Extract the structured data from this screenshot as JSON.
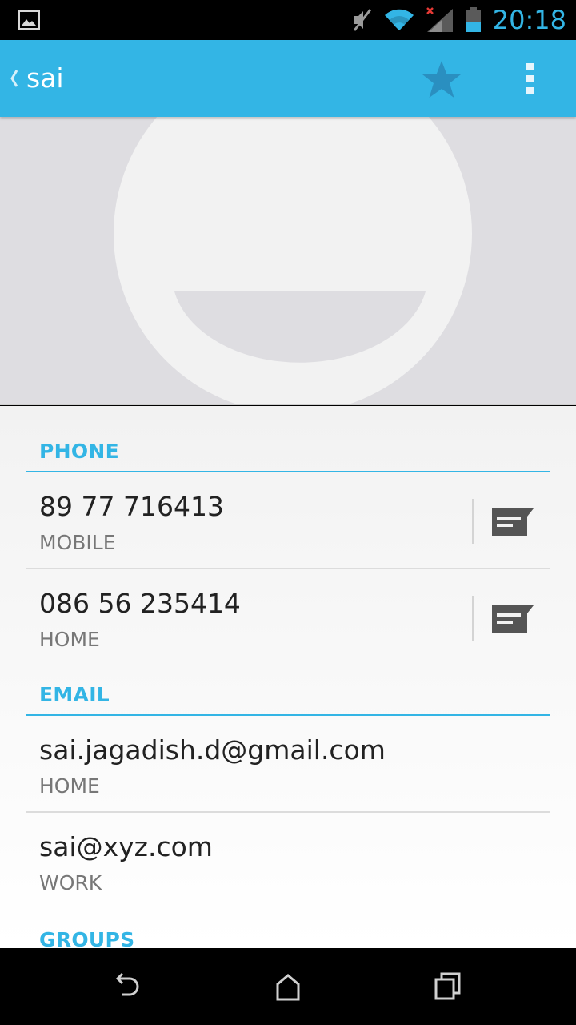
{
  "status_bar": {
    "time": "20:18",
    "icons": [
      "gallery-icon",
      "mute-icon",
      "wifi-icon",
      "signal-icon",
      "battery-icon"
    ],
    "time_color": "#33b5e5"
  },
  "action_bar": {
    "title": "sai",
    "background": "#33b5e5",
    "icons": [
      "up-arrow-icon",
      "star-icon",
      "overflow-menu-icon"
    ]
  },
  "contact_photo": {
    "icon": "default-contact-avatar-icon"
  },
  "sections": {
    "phone": {
      "header": "PHONE",
      "entries": [
        {
          "value": "89 77 716413",
          "label": "MOBILE"
        },
        {
          "value": "086 56 235414",
          "label": "HOME"
        }
      ]
    },
    "email": {
      "header": "EMAIL",
      "entries": [
        {
          "value": "sai.jagadish.d@gmail.com",
          "label": "HOME"
        },
        {
          "value": "sai@xyz.com",
          "label": "WORK"
        }
      ]
    },
    "groups": {
      "header": "GROUPS"
    }
  },
  "nav_bar": {
    "buttons": [
      "back-icon",
      "home-icon",
      "recents-icon"
    ]
  }
}
